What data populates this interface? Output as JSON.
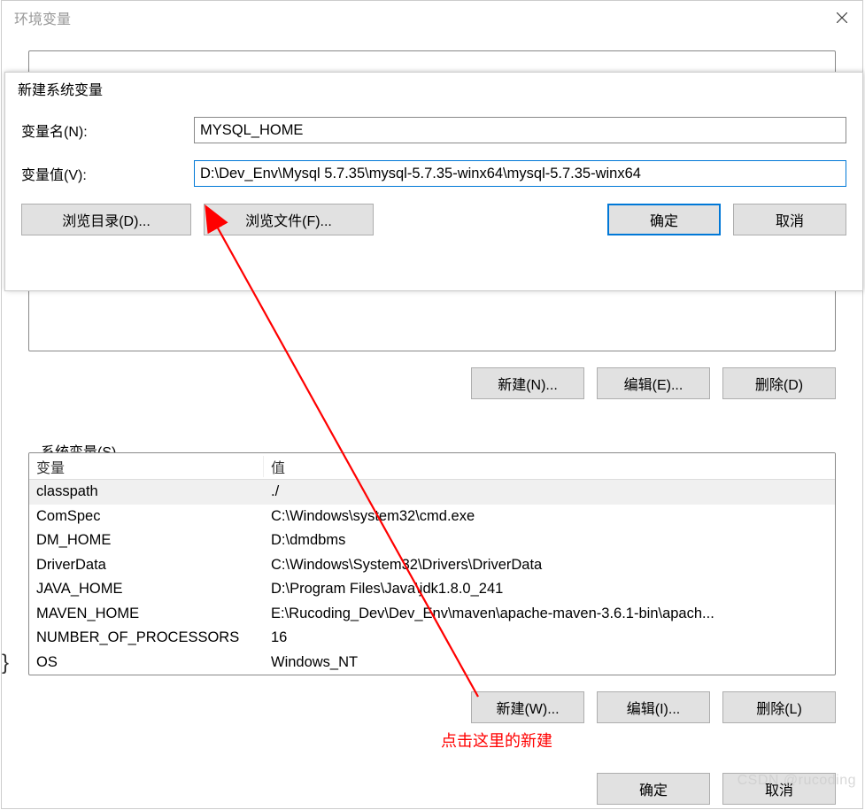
{
  "outer": {
    "title": "环境变量",
    "upper_buttons": {
      "new": "新建(N)...",
      "edit": "编辑(E)...",
      "delete": "删除(D)"
    },
    "sys_label": "系统变量(S)",
    "table": {
      "header_var": "变量",
      "header_val": "值",
      "rows": [
        {
          "name": "classpath",
          "value": "./"
        },
        {
          "name": "ComSpec",
          "value": "C:\\Windows\\system32\\cmd.exe"
        },
        {
          "name": "DM_HOME",
          "value": "D:\\dmdbms"
        },
        {
          "name": "DriverData",
          "value": "C:\\Windows\\System32\\Drivers\\DriverData"
        },
        {
          "name": "JAVA_HOME",
          "value": "D:\\Program Files\\Java\\jdk1.8.0_241"
        },
        {
          "name": "MAVEN_HOME",
          "value": "E:\\Rucoding_Dev\\Dev_Env\\maven\\apache-maven-3.6.1-bin\\apach..."
        },
        {
          "name": "NUMBER_OF_PROCESSORS",
          "value": "16"
        },
        {
          "name": "OS",
          "value": "Windows_NT"
        }
      ]
    },
    "lower_buttons": {
      "new": "新建(W)...",
      "edit": "编辑(I)...",
      "delete": "删除(L)"
    },
    "ok": "确定",
    "cancel": "取消"
  },
  "inner": {
    "title": "新建系统变量",
    "name_label": "变量名(N):",
    "name_value": "MYSQL_HOME",
    "value_label": "变量值(V):",
    "value_value": "D:\\Dev_Env\\Mysql 5.7.35\\mysql-5.7.35-winx64\\mysql-5.7.35-winx64",
    "browse_dir": "浏览目录(D)...",
    "browse_file": "浏览文件(F)...",
    "ok": "确定",
    "cancel": "取消"
  },
  "annotation": {
    "text": "点击这里的新建"
  },
  "watermark": "CSDN @rucoding"
}
